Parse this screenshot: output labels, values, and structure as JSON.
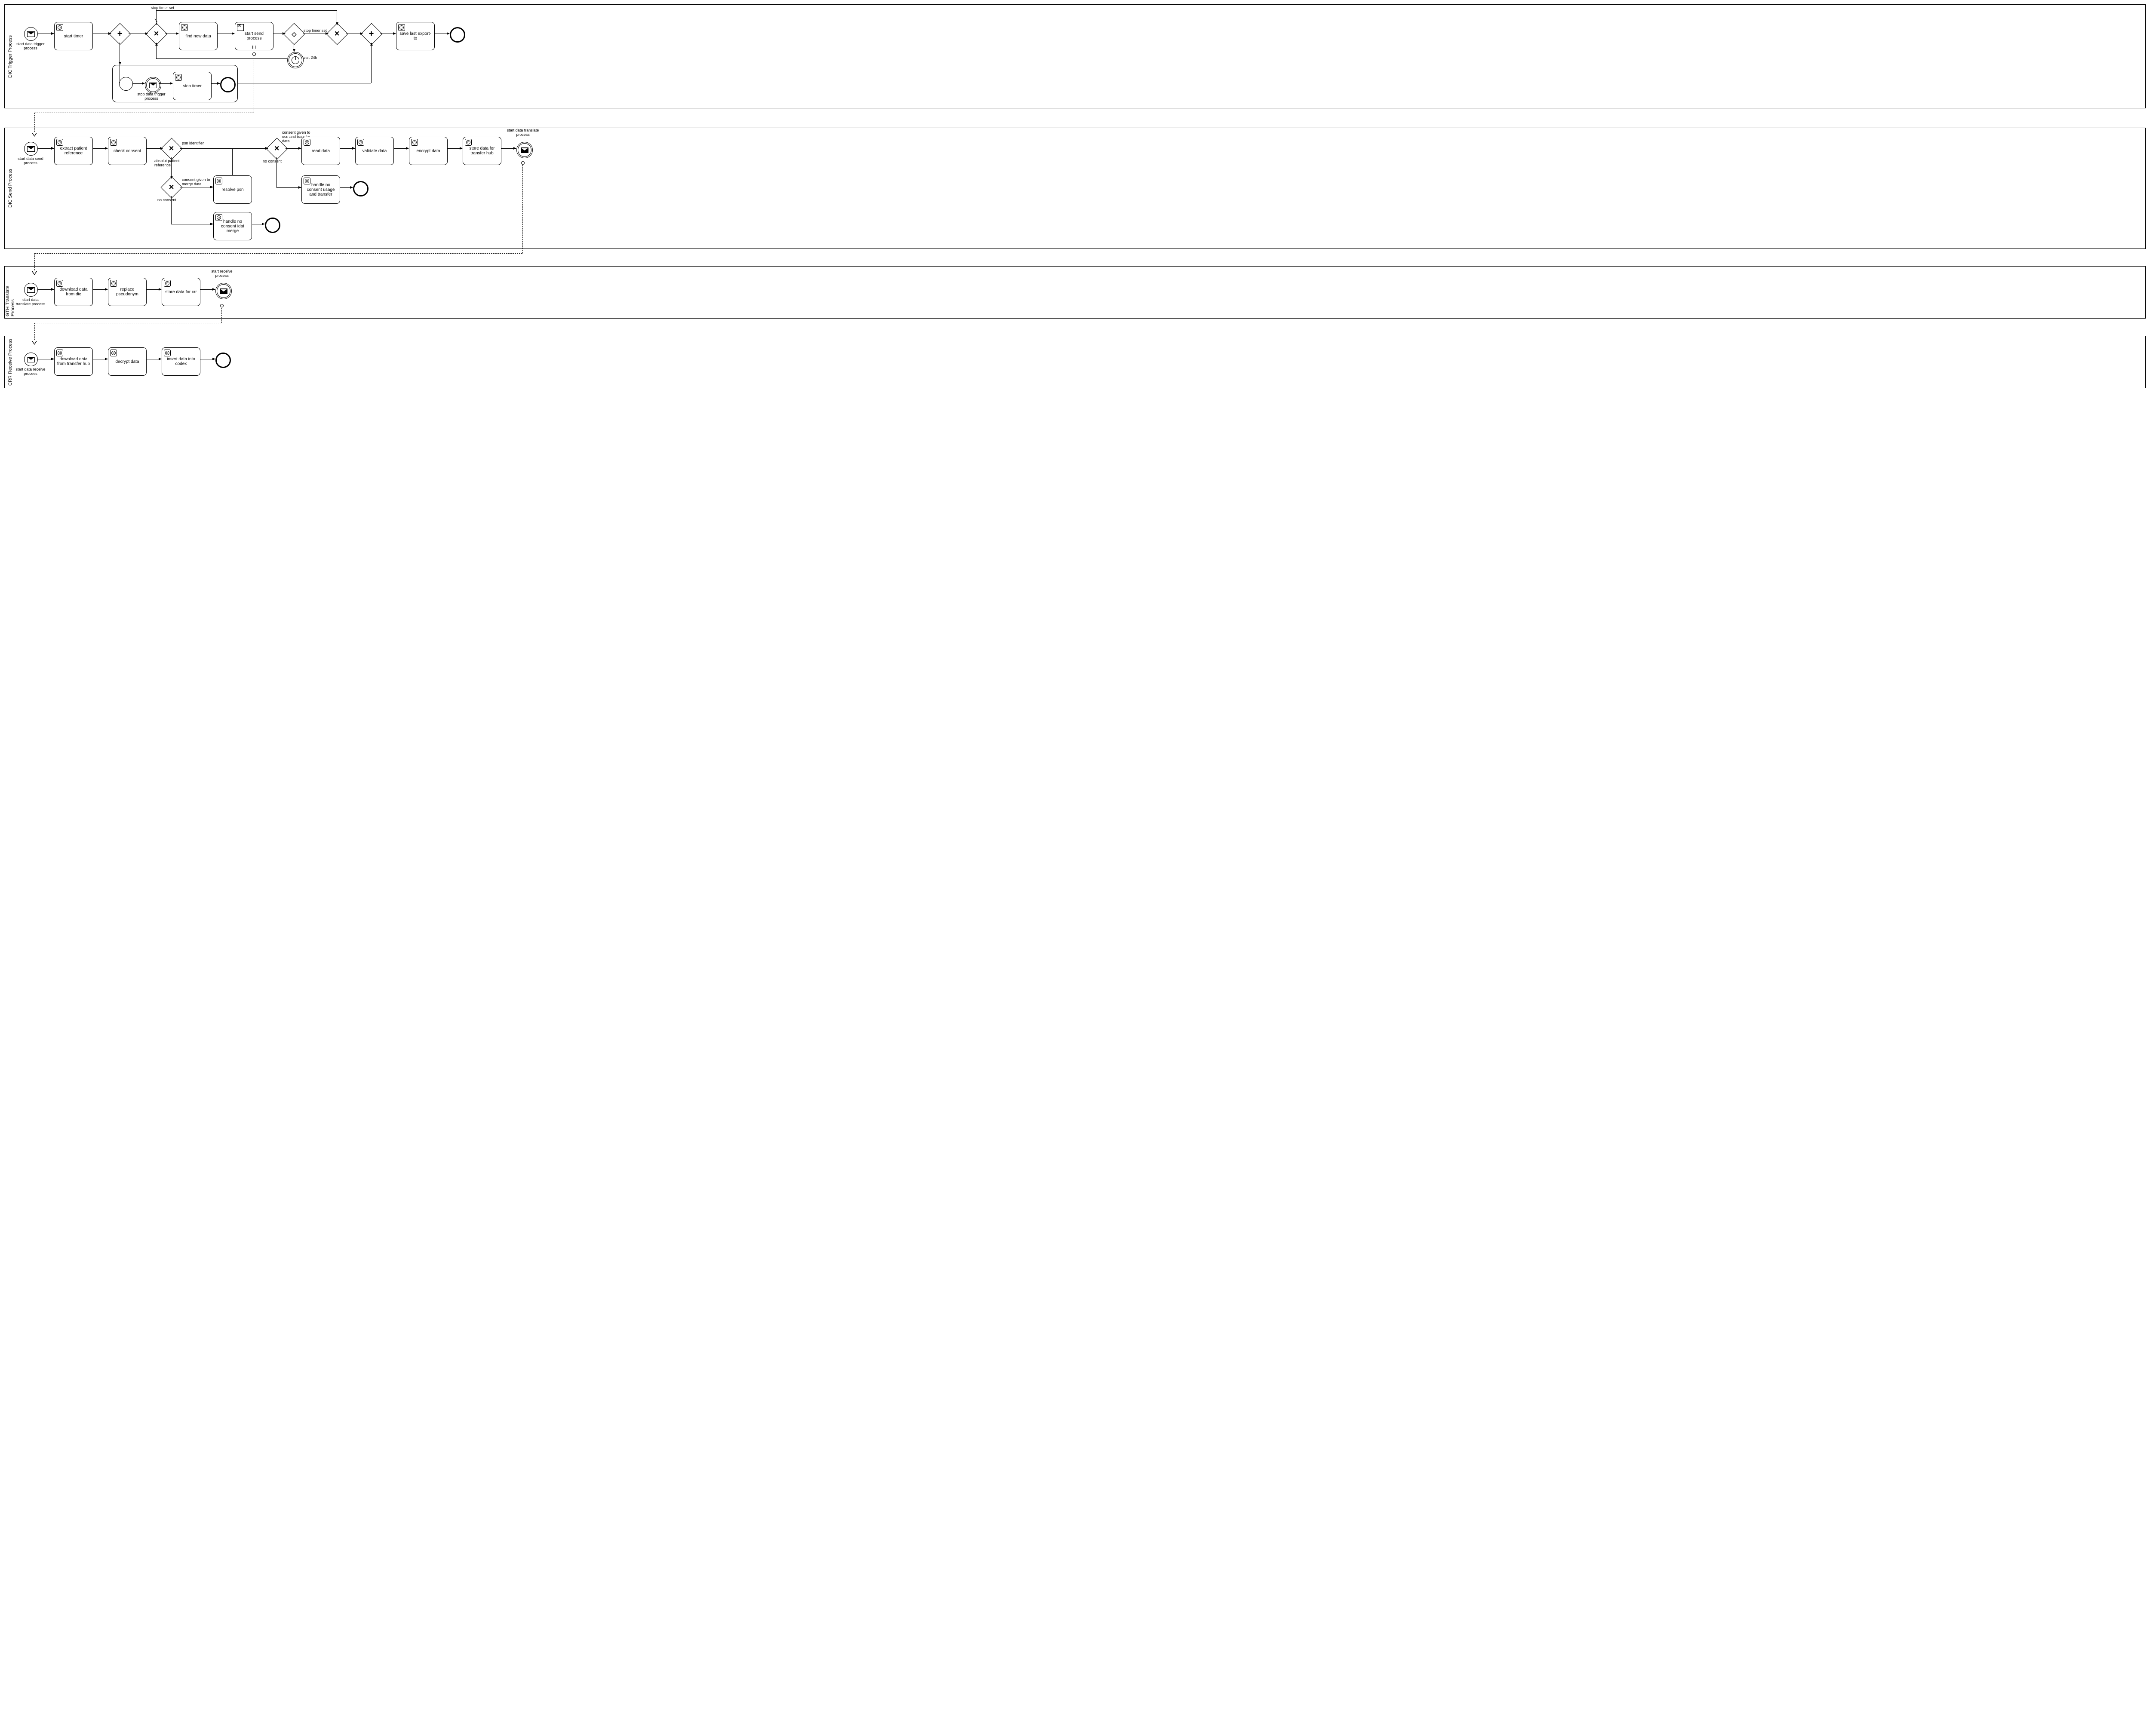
{
  "pools": {
    "p1": {
      "label": "DIC Trigger Process"
    },
    "p2": {
      "label": "DIC Send Process"
    },
    "p3": {
      "label": "GTH Translate Process"
    },
    "p4": {
      "label": "CRR Receive Process"
    }
  },
  "p1": {
    "start_label": "start data trigger process",
    "start_timer": "start timer",
    "find_new_data": "find new data",
    "start_send": "start send process",
    "stop_timer_set_top": "stop timer set",
    "stop_timer_set_right": "stop timer set",
    "wait_24h": "wait 24h",
    "save_last": "save last export-to",
    "sub_start_label": "stop data trigger process",
    "stop_timer": "stop timer"
  },
  "p2": {
    "start_label": "start data send process",
    "extract_patient": "extract patient reference",
    "check_consent": "check consent",
    "psn_identifier": "psn identifier",
    "absolut_patient": "absolut patient reference",
    "consent_merge": "consent given to merge data",
    "no_consent1": "no consent",
    "resolve_psn": "resolve psn",
    "handle_idat": "handle no consent idat merge",
    "consent_use": "consent given to use and transfer data",
    "no_consent2": "no consent",
    "read_data": "read data",
    "handle_usage": "handle no consent usage and transfer",
    "validate_data": "validate data",
    "encrypt_data": "encrypt data",
    "store_data": "store data for transfer hub",
    "end_label": "start data translate process"
  },
  "p3": {
    "start_label": "start data translate process",
    "download_dic": "download data from dic",
    "replace_psn": "replace pseudonym",
    "store_crr": "store data for crr",
    "end_label": "start receive process"
  },
  "p4": {
    "start_label": "start data receive process",
    "download_hub": "download data from transfer hub",
    "decrypt": "decrypt data",
    "insert_codex": "insert data into codex"
  }
}
